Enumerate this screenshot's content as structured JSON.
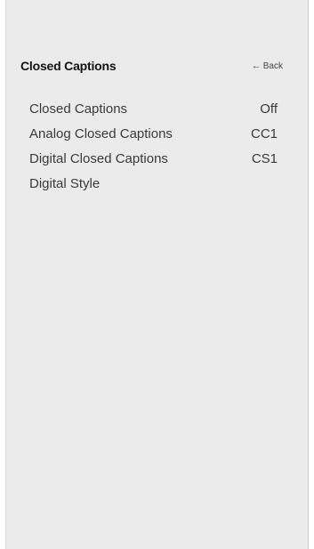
{
  "header": {
    "title": "Closed Captions",
    "back_label": "Back"
  },
  "menu": {
    "items": [
      {
        "label": "Closed Captions",
        "value": "Off"
      },
      {
        "label": "Analog Closed Captions",
        "value": "CC1"
      },
      {
        "label": "Digital Closed Captions",
        "value": "CS1"
      },
      {
        "label": "Digital Style",
        "value": ""
      }
    ]
  }
}
